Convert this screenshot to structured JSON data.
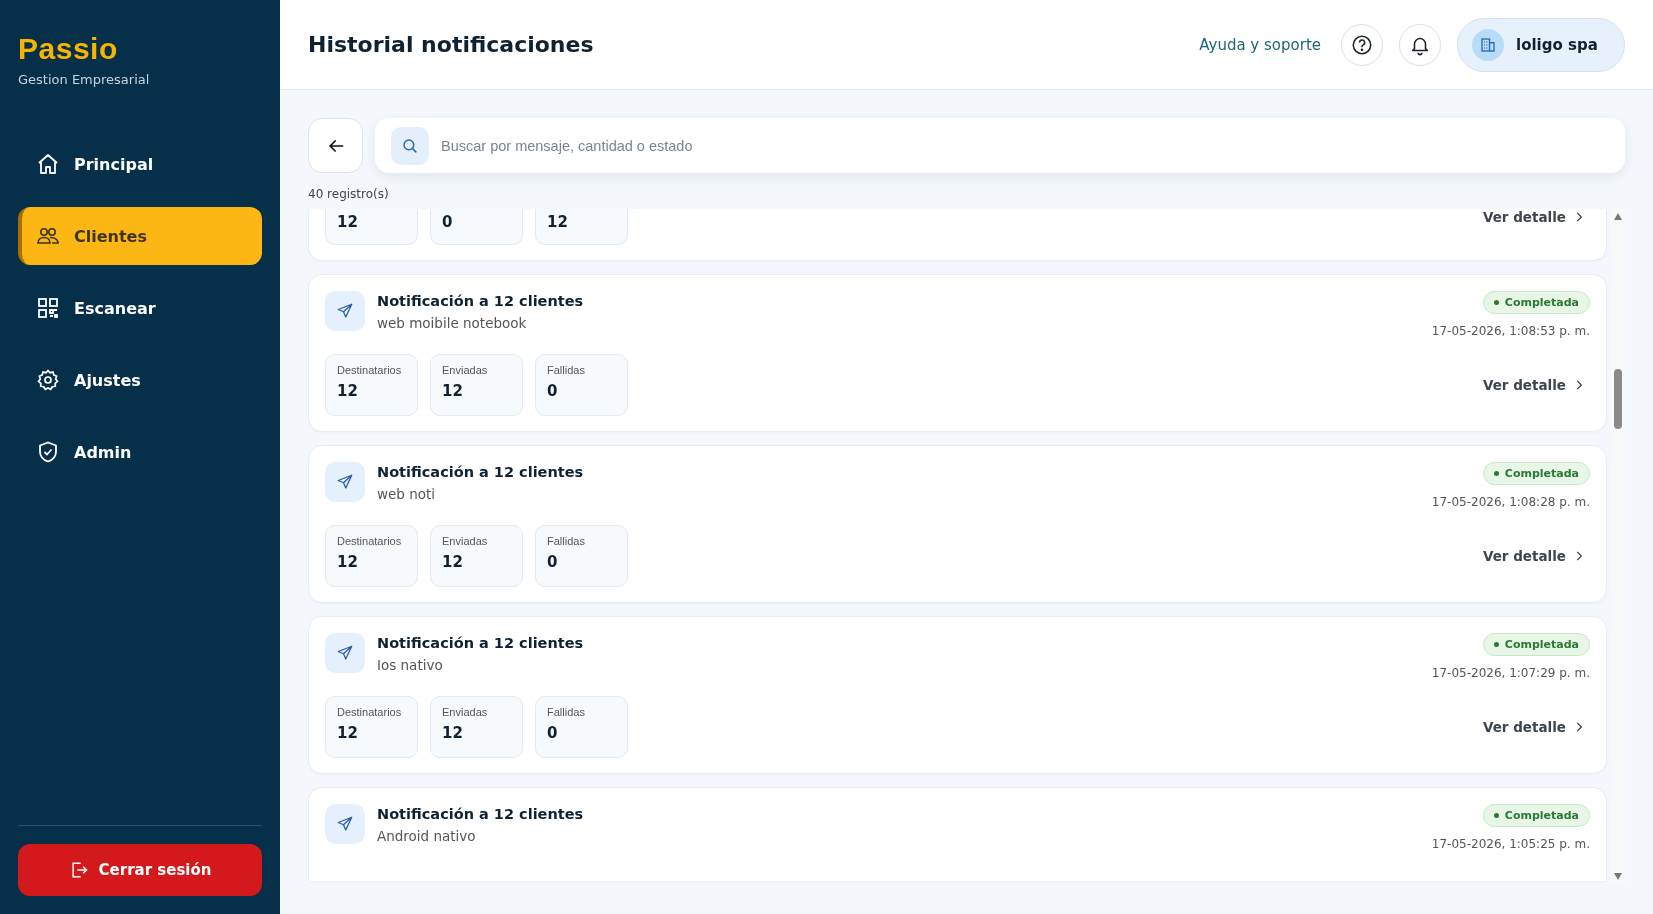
{
  "sidebar": {
    "brand": "Passio",
    "tagline": "Gestion Empresarial",
    "items": [
      {
        "label": "Principal",
        "selected": false
      },
      {
        "label": "Clientes",
        "selected": true
      },
      {
        "label": "Escanear",
        "selected": false
      },
      {
        "label": "Ajustes",
        "selected": false
      },
      {
        "label": "Admin",
        "selected": false
      }
    ],
    "logout": "Cerrar sesión"
  },
  "header": {
    "title": "Historial notificaciones",
    "help_link": "Ayuda y soporte",
    "account": "loligo spa"
  },
  "search": {
    "placeholder": "Buscar por mensaje, cantidad o estado"
  },
  "record_count": "40 registro(s)",
  "notifications": [
    {
      "kind": "cut_top",
      "stats": [
        {
          "value": "12"
        },
        {
          "value": "0"
        },
        {
          "value": "12"
        }
      ],
      "detail_link": "Ver detalle"
    },
    {
      "kind": "full",
      "title": "Notificación a 12 clientes",
      "message": "web moibile notebook",
      "status": "Completada",
      "date": "17-05-2026, 1:08:53 p. m.",
      "stats": [
        {
          "label": "Destinatarios",
          "value": "12"
        },
        {
          "label": "Enviadas",
          "value": "12"
        },
        {
          "label": "Fallidas",
          "value": "0"
        }
      ],
      "detail_link": "Ver detalle"
    },
    {
      "kind": "full",
      "title": "Notificación a 12 clientes",
      "message": "web noti",
      "status": "Completada",
      "date": "17-05-2026, 1:08:28 p. m.",
      "stats": [
        {
          "label": "Destinatarios",
          "value": "12"
        },
        {
          "label": "Enviadas",
          "value": "12"
        },
        {
          "label": "Fallidas",
          "value": "0"
        }
      ],
      "detail_link": "Ver detalle"
    },
    {
      "kind": "full",
      "title": "Notificación a 12 clientes",
      "message": "Ios nativo",
      "status": "Completada",
      "date": "17-05-2026, 1:07:29 p. m.",
      "stats": [
        {
          "label": "Destinatarios",
          "value": "12"
        },
        {
          "label": "Enviadas",
          "value": "12"
        },
        {
          "label": "Fallidas",
          "value": "0"
        }
      ],
      "detail_link": "Ver detalle"
    },
    {
      "kind": "cut_bottom",
      "title": "Notificación a 12 clientes",
      "message": "Android nativo",
      "status": "Completada",
      "date": "17-05-2026, 1:05:25 p. m."
    }
  ]
}
